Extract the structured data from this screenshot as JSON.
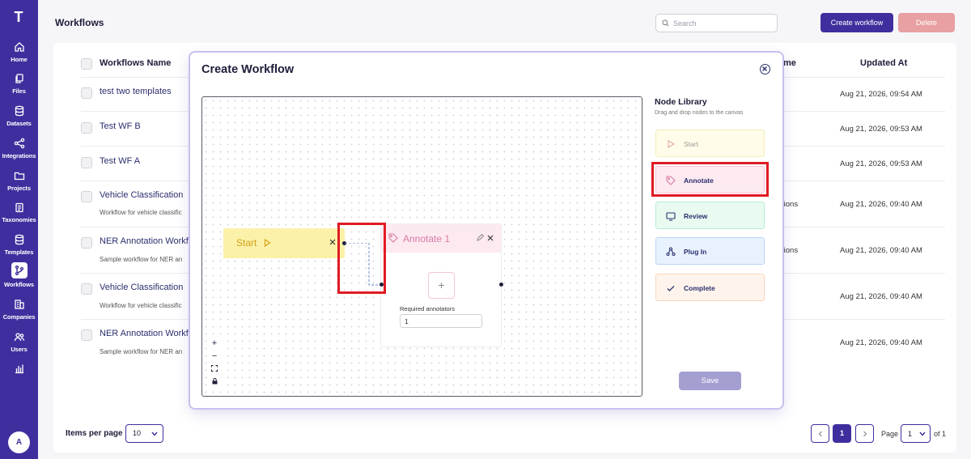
{
  "sidebar": {
    "logo": "T",
    "items": [
      {
        "label": "Home",
        "icon": "home-icon"
      },
      {
        "label": "Files",
        "icon": "files-icon"
      },
      {
        "label": "Datasets",
        "icon": "database-icon"
      },
      {
        "label": "Integrations",
        "icon": "share-icon"
      },
      {
        "label": "Projects",
        "icon": "folder-icon"
      },
      {
        "label": "Taxonomies",
        "icon": "clipboard-icon"
      },
      {
        "label": "Templates",
        "icon": "database-icon"
      },
      {
        "label": "Workflows",
        "icon": "workflow-icon",
        "active": true
      },
      {
        "label": "Companies",
        "icon": "building-icon"
      },
      {
        "label": "Users",
        "icon": "users-icon"
      },
      {
        "label": "",
        "icon": "bar-chart-icon"
      }
    ],
    "avatar": "A"
  },
  "header": {
    "title": "Workflows",
    "search_placeholder": "Search",
    "create_label": "Create workflow",
    "delete_label": "Delete"
  },
  "table": {
    "columns": [
      "Workflows Name",
      "me",
      "Updated At"
    ],
    "rows": [
      {
        "name": "test two templates",
        "desc": "",
        "template": "",
        "updated": "Aug 21, 2026, 09:54 AM"
      },
      {
        "name": "Test WF B",
        "desc": "",
        "template": "",
        "updated": "Aug 21, 2026, 09:53 AM"
      },
      {
        "name": "Test WF A",
        "desc": "",
        "template": "",
        "updated": "Aug 21, 2026, 09:53 AM"
      },
      {
        "name": "Vehicle Classification",
        "desc": "Workflow for vehicle classific",
        "template": "tions",
        "updated": "Aug 21, 2026, 09:40 AM"
      },
      {
        "name": "NER Annotation Workf",
        "desc": "Sample workflow for NER an",
        "template": "tions",
        "updated": "Aug 21, 2026, 09:40 AM"
      },
      {
        "name": "Vehicle Classification",
        "desc": "Workflow for vehicle classific",
        "template": "",
        "updated": "Aug 21, 2026, 09:40 AM"
      },
      {
        "name": "NER Annotation Workf",
        "desc": "Sample workflow for NER an",
        "template": "",
        "updated": "Aug 21, 2026, 09:40 AM"
      }
    ]
  },
  "footer": {
    "items_per_page_label": "Items per page",
    "items_per_page_value": "10",
    "current_page": "1",
    "page_label": "Page",
    "page_select_value": "1",
    "of_label": "of 1"
  },
  "modal": {
    "title": "Create Workflow",
    "canvas": {
      "start_node": {
        "label": "Start"
      },
      "annotate_node": {
        "label": "Annotate 1",
        "plus": "+",
        "required_label": "Required annotators",
        "required_value": "1"
      },
      "zoom_controls": [
        "+",
        "−",
        "⛶",
        "🔒"
      ]
    },
    "library": {
      "title": "Node Library",
      "subtitle": "Drag and drop nodes to the canvas",
      "items": [
        {
          "label": "Start",
          "icon": "play-icon"
        },
        {
          "label": "Annotate",
          "icon": "tag-icon"
        },
        {
          "label": "Review",
          "icon": "monitor-icon"
        },
        {
          "label": "Plug In",
          "icon": "plugin-icon"
        },
        {
          "label": "Complete",
          "icon": "check-icon"
        }
      ]
    },
    "save_label": "Save"
  },
  "colors": {
    "brand": "#3f2f9e",
    "delete": "#e9a0a2",
    "highlight": "#e01b24",
    "start_node": "#fbf1a8",
    "annotate_node": "#fde9f0"
  }
}
